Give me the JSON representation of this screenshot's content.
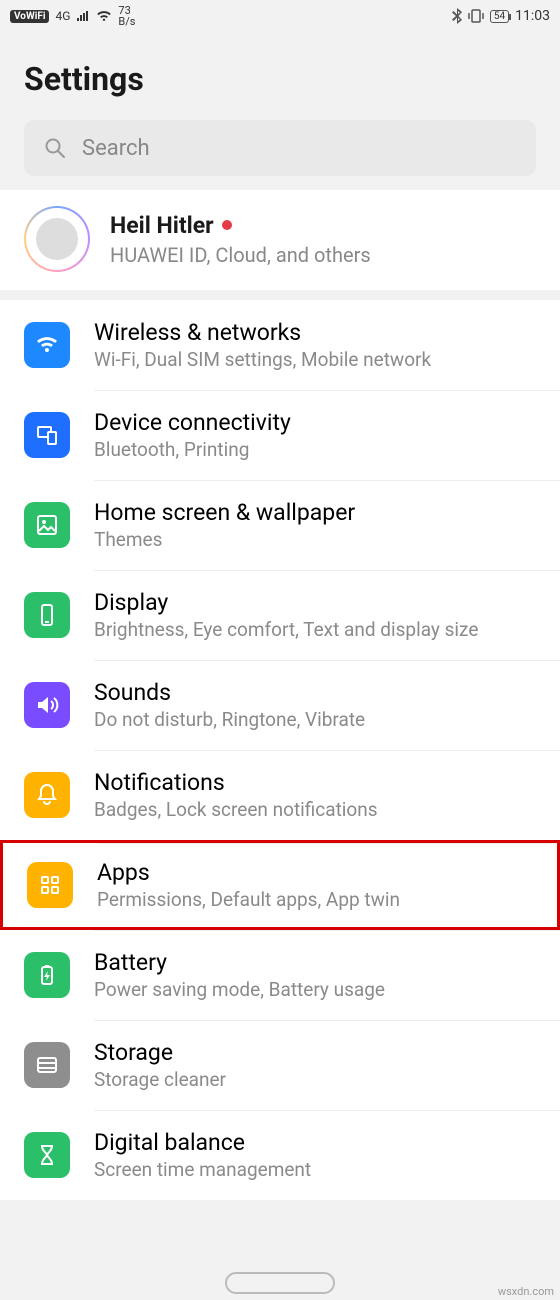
{
  "status": {
    "vowifi_label": "VoWiFi",
    "network_label": "4G",
    "speed_top": "73",
    "speed_unit": "B/s",
    "battery": "54",
    "time": "11:03"
  },
  "header": {
    "title": "Settings"
  },
  "search": {
    "placeholder": "Search"
  },
  "account": {
    "name": "Heil Hitler",
    "subtitle": "HUAWEI ID, Cloud, and others"
  },
  "items": [
    {
      "icon": "wifi-icon",
      "color": "bg-blue1",
      "title": "Wireless & networks",
      "sub": "Wi-Fi, Dual SIM settings, Mobile network"
    },
    {
      "icon": "devices-icon",
      "color": "bg-blue2",
      "title": "Device connectivity",
      "sub": "Bluetooth, Printing"
    },
    {
      "icon": "image-icon",
      "color": "bg-green",
      "title": "Home screen & wallpaper",
      "sub": "Themes"
    },
    {
      "icon": "phone-icon",
      "color": "bg-green",
      "title": "Display",
      "sub": "Brightness, Eye comfort, Text and display size"
    },
    {
      "icon": "sound-icon",
      "color": "bg-purple",
      "title": "Sounds",
      "sub": "Do not disturb, Ringtone, Vibrate"
    },
    {
      "icon": "bell-icon",
      "color": "bg-yellow",
      "title": "Notifications",
      "sub": "Badges, Lock screen notifications"
    },
    {
      "icon": "grid-icon",
      "color": "bg-yellow",
      "title": "Apps",
      "sub": "Permissions, Default apps, App twin",
      "highlight": true
    },
    {
      "icon": "battery-icon",
      "color": "bg-green",
      "title": "Battery",
      "sub": "Power saving mode, Battery usage"
    },
    {
      "icon": "storage-icon",
      "color": "bg-gray",
      "title": "Storage",
      "sub": "Storage cleaner"
    },
    {
      "icon": "hourglass-icon",
      "color": "bg-green",
      "title": "Digital balance",
      "sub": "Screen time management"
    }
  ],
  "watermark": "wsxdn.com"
}
